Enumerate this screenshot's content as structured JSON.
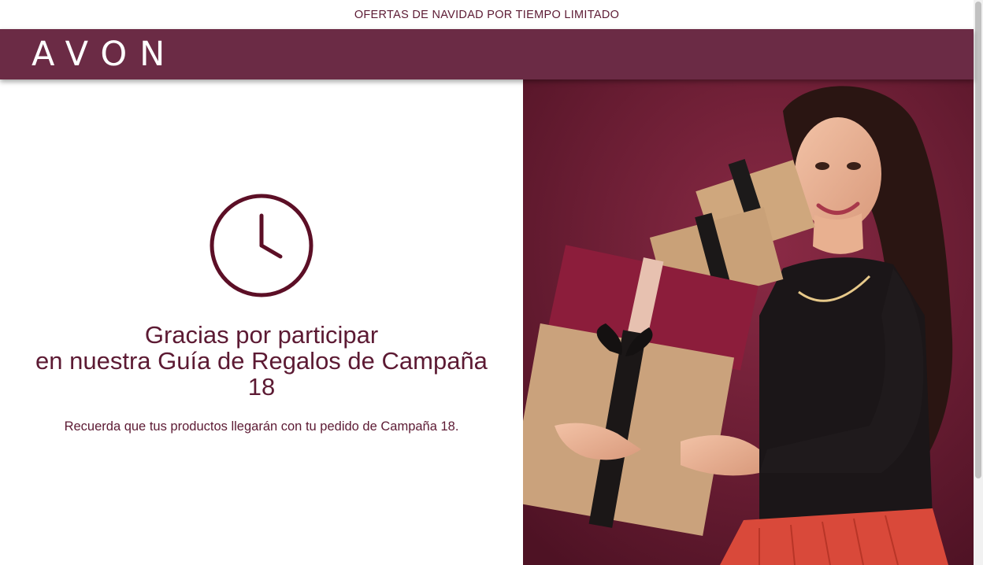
{
  "promo_bar": {
    "text": "OFERTAS DE NAVIDAD POR TIEMPO LIMITADO"
  },
  "header": {
    "logo_text": "AVON",
    "background_color": "#6b2b45"
  },
  "main": {
    "icon": "clock-icon",
    "heading_lines": [
      "Gracias por participar",
      "en nuestra Guía de Regalos de Campaña",
      "18"
    ],
    "reminder": "Recuerda que tus productos llegarán con tu pedido de Campaña 18."
  },
  "hero": {
    "image": "woman-holding-gift-boxes",
    "alt": "Mujer sonriente sosteniendo cajas de regalo"
  },
  "colors": {
    "accent": "#5c1a33",
    "header": "#6b2b45",
    "hero_background": "#6a1f33"
  }
}
